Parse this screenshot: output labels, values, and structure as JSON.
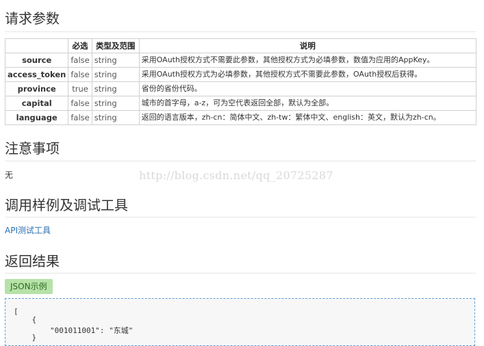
{
  "sections": {
    "request_params": "请求参数",
    "notes": "注意事项",
    "examples": "调用样例及调试工具",
    "result": "返回结果"
  },
  "table": {
    "headers": [
      "",
      "必选",
      "类型及范围",
      "说明"
    ],
    "rows": [
      {
        "name": "source",
        "required": "false",
        "type": "string",
        "desc": "采用OAuth授权方式不需要此参数，其他授权方式为必填参数，数值为应用的AppKey。"
      },
      {
        "name": "access_token",
        "required": "false",
        "type": "string",
        "desc": "采用OAuth授权方式为必填参数，其他授权方式不需要此参数，OAuth授权后获得。"
      },
      {
        "name": "province",
        "required": "true",
        "type": "string",
        "desc": "省份的省份代码。"
      },
      {
        "name": "capital",
        "required": "false",
        "type": "string",
        "desc": "城市的首字母，a-z，可为空代表返回全部，默认为全部。"
      },
      {
        "name": "language",
        "required": "false",
        "type": "string",
        "desc": "返回的语言版本，zh-cn：简体中文、zh-tw：繁体中文、english：英文，默认为zh-cn。"
      }
    ]
  },
  "notes_text": "无",
  "watermark": "http://blog.csdn.net/qq_20725287",
  "api_link": "API测试工具",
  "json_tag": "JSON示例",
  "code": {
    "line1": "[",
    "line2": "    {",
    "line3": "        \"001011001\": \"东城\"",
    "line4": "    }"
  }
}
